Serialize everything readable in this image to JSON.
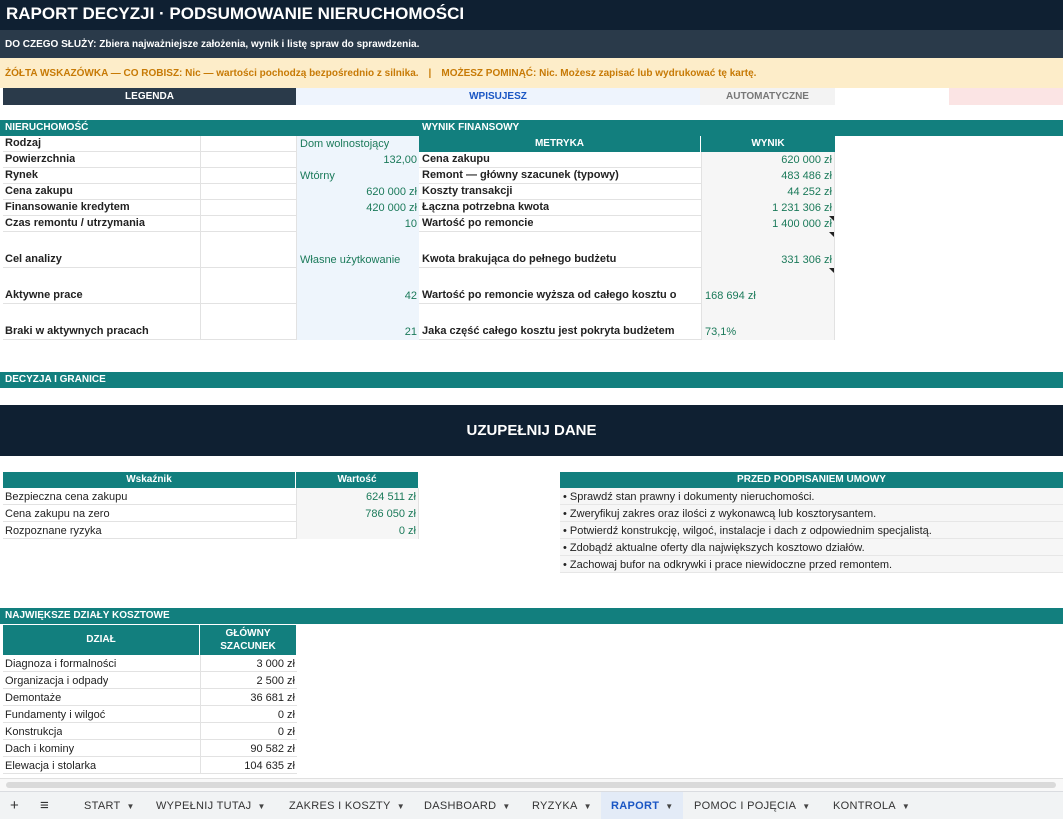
{
  "title": "RAPORT DECYZJI · PODSUMOWANIE NIERUCHOMOŚCI",
  "description": {
    "key": "DO CZEGO SŁUŻY:",
    "text": " Zbiera najważniejsze założenia, wynik i listę spraw do sprawdzenia."
  },
  "hint": {
    "left": "ŻÓŁTA WSKAZÓWKA — CO ROBISZ: Nic — wartości pochodzą bezpośrednio z silnika.",
    "sep": "|",
    "right": "MOŻESZ POMINĄĆ: Nic. Możesz zapisać lub wydrukować tę kartę."
  },
  "legend": {
    "label": "LEGENDA",
    "input": "WPISUJESZ",
    "auto": "AUTOMATYCZNE"
  },
  "property": {
    "header": "NIERUCHOMOŚĆ",
    "rows": [
      {
        "label": "Rodzaj",
        "value": "Dom wolnostojący"
      },
      {
        "label": "Powierzchnia",
        "value": "132,00"
      },
      {
        "label": "Rynek",
        "value": "Wtórny"
      },
      {
        "label": "Cena zakupu",
        "value": "620 000 zł"
      },
      {
        "label": "Finansowanie kredytem",
        "value": "420 000 zł"
      },
      {
        "label": "Czas remontu / utrzymania",
        "value": "10"
      },
      {
        "label": "Cel analizy",
        "value": "Własne użytkowanie"
      },
      {
        "label": "Aktywne prace",
        "value": "42"
      },
      {
        "label": "Braki w aktywnych pracach",
        "value": "21"
      }
    ]
  },
  "financial": {
    "header": "WYNIK FINANSOWY",
    "col_metric": "METRYKA",
    "col_result": "WYNIK",
    "rows": [
      {
        "label": "Cena zakupu",
        "value": "620 000 zł"
      },
      {
        "label": "Remont — główny szacunek (typowy)",
        "value": "483 486 zł"
      },
      {
        "label": "Koszty transakcji",
        "value": "44 252 zł"
      },
      {
        "label": "Łączna potrzebna kwota",
        "value": "1 231 306 zł"
      },
      {
        "label": "Wartość po remoncie",
        "value": "1 400 000 zł"
      },
      {
        "label": "Kwota brakująca do pełnego budżetu",
        "value": "331 306 zł"
      },
      {
        "label": "Wartość po remoncie wyższa od całego kosztu o",
        "value": "168 694 zł"
      },
      {
        "label": "Jaka część całego kosztu jest pokryta budżetem",
        "value": "73,1%"
      }
    ]
  },
  "decision": {
    "header": "DECYZJA I GRANICE",
    "banner": "UZUPEŁNIJ DANE"
  },
  "indicators": {
    "col_name": "Wskaźnik",
    "col_value": "Wartość",
    "rows": [
      {
        "label": "Bezpieczna cena zakupu",
        "value": "624 511 zł"
      },
      {
        "label": "Cena zakupu na zero",
        "value": "786 050 zł"
      },
      {
        "label": "Rozpoznane ryzyka",
        "value": "0 zł"
      }
    ]
  },
  "checklist": {
    "header": "PRZED PODPISANIEM UMOWY",
    "items": [
      "• Sprawdź stan prawny i dokumenty nieruchomości.",
      "• Zweryfikuj zakres oraz ilości z wykonawcą lub kosztorysantem.",
      "• Potwierdź konstrukcję, wilgoć, instalacje i dach z odpowiednim specjalistą.",
      "• Zdobądź aktualne oferty dla największych kosztowo działów.",
      "• Zachowaj bufor na odkrywki i prace niewidoczne przed remontem."
    ]
  },
  "costs": {
    "header": "NAJWIĘKSZE DZIAŁY KOSZTOWE",
    "col_dept": "DZIAŁ",
    "col_est1": "GŁÓWNY",
    "col_est2": "SZACUNEK",
    "rows": [
      {
        "label": "Diagnoza i formalności",
        "value": "3 000 zł"
      },
      {
        "label": "Organizacja i odpady",
        "value": "2 500 zł"
      },
      {
        "label": "Demontaże",
        "value": "36 681 zł"
      },
      {
        "label": "Fundamenty i wilgoć",
        "value": "0 zł"
      },
      {
        "label": "Konstrukcja",
        "value": "0 zł"
      },
      {
        "label": "Dach i kominy",
        "value": "90 582 zł"
      },
      {
        "label": "Elewacja i stolarka",
        "value": "104 635 zł"
      }
    ]
  },
  "tabs": {
    "add": "+",
    "menu": "≡",
    "items": [
      {
        "label": "START",
        "active": false
      },
      {
        "label": "WYPEŁNIJ TUTAJ",
        "active": false
      },
      {
        "label": "ZAKRES I KOSZTY",
        "active": false
      },
      {
        "label": "DASHBOARD",
        "active": false
      },
      {
        "label": "RYZYKA",
        "active": false
      },
      {
        "label": "RAPORT",
        "active": true
      },
      {
        "label": "POMOC I POJĘCIA",
        "active": false
      },
      {
        "label": "KONTROLA",
        "active": false
      }
    ]
  },
  "colors": {
    "title_bg": "#0f2032",
    "teal": "#127f7e",
    "hint_bg": "#fdedc9",
    "hint_text": "#c77a06",
    "value_green": "#1b7a5a",
    "active_tab": "#1a56c4"
  }
}
